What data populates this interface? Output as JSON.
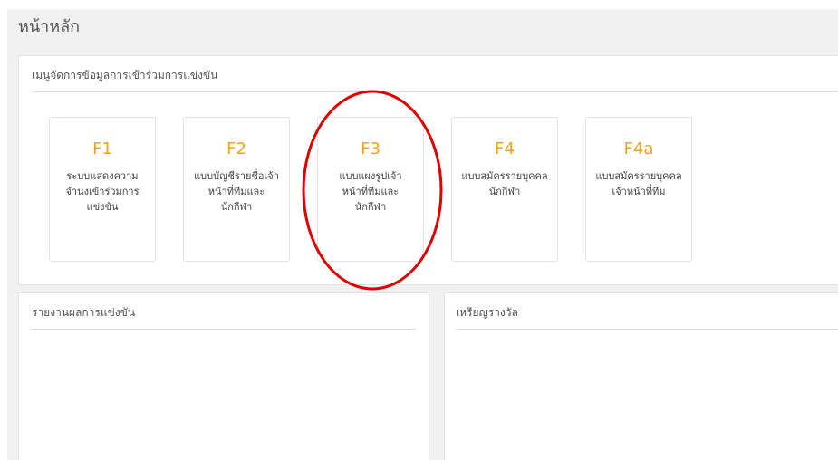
{
  "page": {
    "title": "หน้าหลัก"
  },
  "menu_panel": {
    "header": "เมนูจัดการข้อมูลการเข้าร่วมการแข่งขัน",
    "cards": [
      {
        "code": "F1",
        "label": "ระบบแสดงความจำนงเข้าร่วมการแข่งขัน"
      },
      {
        "code": "F2",
        "label": "แบบบัญชีรายชื่อเจ้าหน้าที่ทีมและนักกีฬา"
      },
      {
        "code": "F3",
        "label": "แบบแผงรูปเจ้าหน้าที่ทีมและนักกีฬา"
      },
      {
        "code": "F4",
        "label": "แบบสมัครรายบุคคลนักกีฬา"
      },
      {
        "code": "F4a",
        "label": "แบบสมัครรายบุคคลเจ้าหน้าที่ทีม"
      }
    ]
  },
  "report_panel": {
    "header": "รายงานผลการแข่งขัน"
  },
  "medal_panel": {
    "header": "เหรียญรางวัล"
  },
  "colors": {
    "card_code": "#f5a21b",
    "annotation": "#e00000",
    "page_background": "#f1f1f1"
  }
}
